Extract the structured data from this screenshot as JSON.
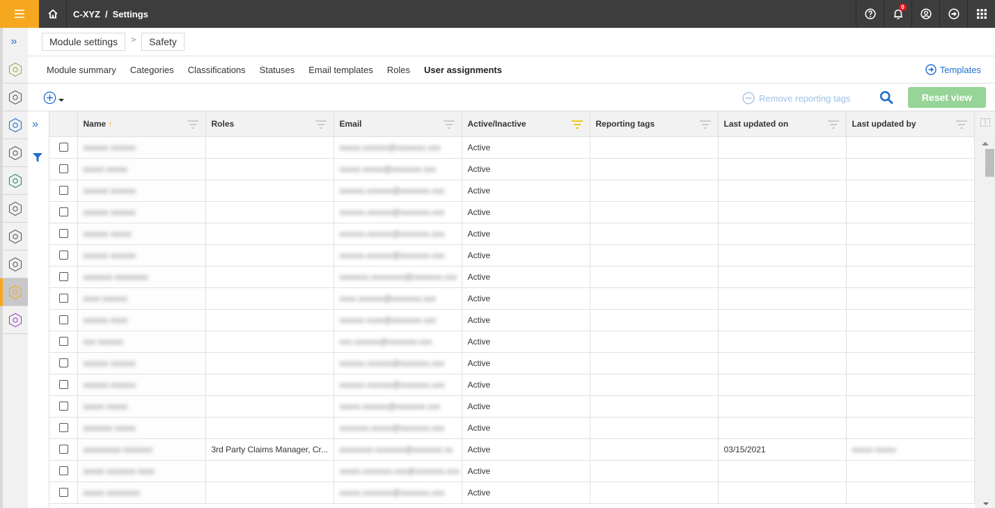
{
  "topbar": {
    "breadcrumb_root": "C-XYZ",
    "breadcrumb_sep": "/",
    "breadcrumb_current": "Settings",
    "notification_count": "0",
    "icons": [
      "help-icon",
      "bell-icon",
      "user-icon",
      "logout-icon",
      "apps-grid-icon"
    ]
  },
  "rail": {
    "items": [
      {
        "name": "module-summary-module",
        "color": "#8fb34a",
        "active": false
      },
      {
        "name": "module-2",
        "color": "#5a5a5a",
        "active": false
      },
      {
        "name": "module-3",
        "color": "#1f6fd0",
        "active": false
      },
      {
        "name": "module-4",
        "color": "#5a5a5a",
        "active": false
      },
      {
        "name": "module-5",
        "color": "#2e8b57",
        "active": false
      },
      {
        "name": "module-6",
        "color": "#5a5a5a",
        "active": false
      },
      {
        "name": "module-7",
        "color": "#5a5a5a",
        "active": false
      },
      {
        "name": "module-8",
        "color": "#5a5a5a",
        "active": false
      },
      {
        "name": "safety-module",
        "color": "#f5a81f",
        "active": true
      },
      {
        "name": "module-10",
        "color": "#a042b8",
        "active": false
      }
    ]
  },
  "breadcrumb": {
    "parent": "Module settings",
    "current": "Safety"
  },
  "tabs": [
    {
      "label": "Module summary",
      "active": false
    },
    {
      "label": "Categories",
      "active": false
    },
    {
      "label": "Classifications",
      "active": false
    },
    {
      "label": "Statuses",
      "active": false
    },
    {
      "label": "Email templates",
      "active": false
    },
    {
      "label": "Roles",
      "active": false
    },
    {
      "label": "User assignments",
      "active": true
    }
  ],
  "templates_link": "Templates",
  "toolbar": {
    "remove_tags_label": "Remove reporting tags",
    "reset_view_label": "Reset view"
  },
  "colors": {
    "accent": "#f5a81f",
    "link": "#1f6fd0",
    "reset_button": "#97d497",
    "topbar": "#3d3d3d"
  },
  "grid": {
    "columns": [
      {
        "label": "Name",
        "sorted": "asc"
      },
      {
        "label": "Roles"
      },
      {
        "label": "Email"
      },
      {
        "label": "Active/Inactive",
        "filtered": true
      },
      {
        "label": "Reporting tags"
      },
      {
        "label": "Last updated on"
      },
      {
        "label": "Last updated by"
      }
    ],
    "rows": [
      {
        "name": "xxxxxx xxxxxx",
        "roles": "",
        "email": "xxxxx.xxxxxx@xxxxxxx.xxx",
        "status": "Active",
        "tags": "",
        "updated_on": "",
        "updated_by": ""
      },
      {
        "name": "xxxxx xxxxx",
        "roles": "",
        "email": "xxxxx.xxxxx@xxxxxxx.xxx",
        "status": "Active",
        "tags": "",
        "updated_on": "",
        "updated_by": ""
      },
      {
        "name": "xxxxxx xxxxxx",
        "roles": "",
        "email": "xxxxxx.xxxxxx@xxxxxxx.xxx",
        "status": "Active",
        "tags": "",
        "updated_on": "",
        "updated_by": ""
      },
      {
        "name": "xxxxxx xxxxxx",
        "roles": "",
        "email": "xxxxxx.xxxxxx@xxxxxxx.xxx",
        "status": "Active",
        "tags": "",
        "updated_on": "",
        "updated_by": ""
      },
      {
        "name": "xxxxxx xxxxx",
        "roles": "",
        "email": "xxxxxx.xxxxxx@xxxxxxx.xxx",
        "status": "Active",
        "tags": "",
        "updated_on": "",
        "updated_by": ""
      },
      {
        "name": "xxxxxx xxxxxx",
        "roles": "",
        "email": "xxxxxx.xxxxxx@xxxxxxx.xxx",
        "status": "Active",
        "tags": "",
        "updated_on": "",
        "updated_by": ""
      },
      {
        "name": "xxxxxxx xxxxxxxx",
        "roles": "",
        "email": "xxxxxxx.xxxxxxxx@xxxxxxx.xxx",
        "status": "Active",
        "tags": "",
        "updated_on": "",
        "updated_by": ""
      },
      {
        "name": "xxxx xxxxxx",
        "roles": "",
        "email": "xxxx.xxxxxx@xxxxxxx.xxx",
        "status": "Active",
        "tags": "",
        "updated_on": "",
        "updated_by": ""
      },
      {
        "name": "xxxxxx xxxx",
        "roles": "",
        "email": "xxxxxx.xxxx@xxxxxxx.xxx",
        "status": "Active",
        "tags": "",
        "updated_on": "",
        "updated_by": ""
      },
      {
        "name": "xxx xxxxxx",
        "roles": "",
        "email": "xxx.xxxxxx@xxxxxxx.xxx",
        "status": "Active",
        "tags": "",
        "updated_on": "",
        "updated_by": ""
      },
      {
        "name": "xxxxxx xxxxxx",
        "roles": "",
        "email": "xxxxxx.xxxxxx@xxxxxxx.xxx",
        "status": "Active",
        "tags": "",
        "updated_on": "",
        "updated_by": ""
      },
      {
        "name": "xxxxxx xxxxxx",
        "roles": "",
        "email": "xxxxxx.xxxxxx@xxxxxxx.xxx",
        "status": "Active",
        "tags": "",
        "updated_on": "",
        "updated_by": ""
      },
      {
        "name": "xxxxx xxxxx",
        "roles": "",
        "email": "xxxxx.xxxxxx@xxxxxxx.xxx",
        "status": "Active",
        "tags": "",
        "updated_on": "",
        "updated_by": ""
      },
      {
        "name": "xxxxxxx xxxxx",
        "roles": "",
        "email": "xxxxxxx.xxxxx@xxxxxxx.xxx",
        "status": "Active",
        "tags": "",
        "updated_on": "",
        "updated_by": ""
      },
      {
        "name": "xxxxxxxxx xxxxxxx",
        "roles": "3rd Party Claims Manager, Cr...",
        "email": "xxxxxxxx.xxxxxxx@xxxxxxx.xx",
        "status": "Active",
        "tags": "",
        "updated_on": "03/15/2021",
        "updated_by": "xxxxx xxxxx"
      },
      {
        "name": "xxxxx xxxxxxx xxxx",
        "roles": "",
        "email": "xxxxx.xxxxxxx.xxx@xxxxxxx.xxx",
        "status": "Active",
        "tags": "",
        "updated_on": "",
        "updated_by": ""
      },
      {
        "name": "xxxxx xxxxxxxx",
        "roles": "",
        "email": "xxxxx.xxxxxxx@xxxxxxx.xxx",
        "status": "Active",
        "tags": "",
        "updated_on": "",
        "updated_by": ""
      }
    ]
  }
}
